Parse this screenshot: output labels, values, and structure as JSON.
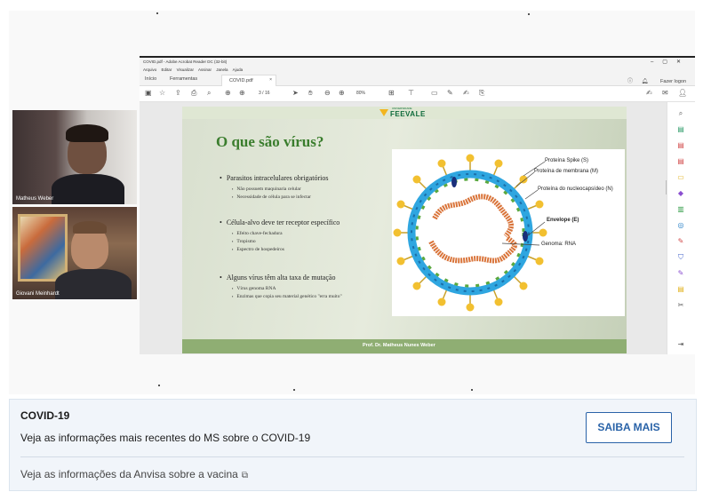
{
  "participants": [
    {
      "name": "Matheus Weber"
    },
    {
      "name": "Giovani Meinhardt"
    }
  ],
  "acrobat": {
    "window_title": "COVID.pdf - Adobe Acrobat Reader DC (32-bit)",
    "menu": [
      "Arquivo",
      "Editar",
      "Visualizar",
      "Assinar",
      "Janela",
      "Ajuda"
    ],
    "tabs": {
      "home": "Início",
      "tools": "Ferramentas",
      "document": "COVID.pdf"
    },
    "login": "Fazer logon",
    "page_indicator": "3 / 16",
    "zoom": "80%"
  },
  "slide": {
    "title": "O que são vírus?",
    "logo": "FEEVALE",
    "logo_sup": "UNIVERSIDADE",
    "sections": [
      {
        "heading": "Parasitos intracelulares obrigatórios",
        "items": [
          "Não possuem maquinaria celular",
          "Necessidade de célula para se infectar"
        ]
      },
      {
        "heading": "Célula-alvo deve ter receptor específico",
        "items": [
          "Efeito chave-fechadura",
          "Tropismo",
          "Espectro de hospedeiros"
        ]
      },
      {
        "heading": "Alguns vírus têm alta taxa de mutação",
        "items": [
          "Vírus genoma RNA",
          "Enzimas que copia seu material genético \"erra muito\""
        ]
      }
    ],
    "diagram_labels": {
      "spike": "Proteína Spike (S)",
      "membrane": "Proteína de membrana (M)",
      "nucleocapsid": "Proteína do nucleocapsídeo (N)",
      "envelope": "Envelope (E)",
      "genome": "Genoma: RNA"
    },
    "footer": "Prof. Dr. Matheus Nunes Weber"
  },
  "card": {
    "title": "COVID-19",
    "subtitle": "Veja as informações mais recentes do MS sobre o COVID-19",
    "button": "SAIBA MAIS",
    "link": "Veja as informações da Anvisa sobre a vacina"
  },
  "colors": {
    "accent": "#2a63a8",
    "slide_title": "#3a7d2d",
    "virus_envelope": "#2fa6e0",
    "rna": "#d9743a",
    "spike": "#f2c030"
  }
}
